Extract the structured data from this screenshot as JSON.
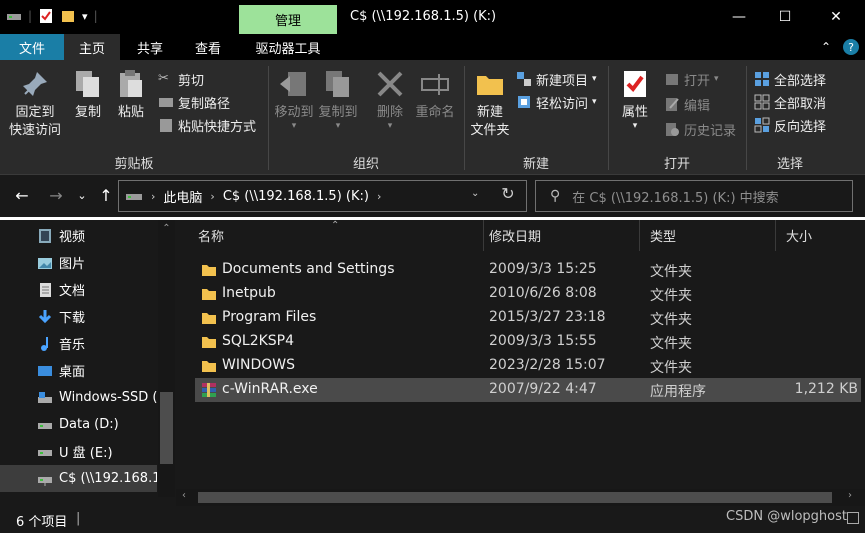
{
  "titlebar": {
    "manage_tab": "管理",
    "title": "C$ (\\\\192.168.1.5) (K:)",
    "minimize": "—",
    "maximize": "☐",
    "close": "✕",
    "qat_icons": [
      "drive-icon",
      "properties-check-icon",
      "new-folder-icon",
      "qat-dropdown-icon"
    ]
  },
  "tabs": {
    "file": "文件",
    "home": "主页",
    "share": "共享",
    "view": "查看",
    "drive_tools": "驱动器工具"
  },
  "ribbon": {
    "clipboard": {
      "label": "剪贴板",
      "pin_quick_access": "固定到\n快速访问",
      "pin_line1": "固定到",
      "pin_line2": "快速访问",
      "copy": "复制",
      "paste": "粘贴",
      "cut": "剪切",
      "copy_path": "复制路径",
      "paste_shortcut": "粘贴快捷方式"
    },
    "organize": {
      "label": "组织",
      "move_to": "移动到",
      "copy_to": "复制到",
      "delete": "删除",
      "rename": "重命名"
    },
    "new": {
      "label": "新建",
      "new_folder_line1": "新建",
      "new_folder_line2": "文件夹",
      "new_item": "新建项目",
      "easy_access": "轻松访问"
    },
    "open": {
      "label": "打开",
      "properties": "属性",
      "open": "打开",
      "edit": "编辑",
      "history": "历史记录"
    },
    "select": {
      "label": "选择",
      "select_all": "全部选择",
      "select_none": "全部取消",
      "invert": "反向选择"
    }
  },
  "address": {
    "this_pc": "此电脑",
    "drive": "C$ (\\\\192.168.1.5) (K:)",
    "search_placeholder": "在 C$ (\\\\192.168.1.5) (K:) 中搜索"
  },
  "navpane": {
    "items": [
      {
        "label": "视频",
        "icon": "video-icon"
      },
      {
        "label": "图片",
        "icon": "pictures-icon"
      },
      {
        "label": "文档",
        "icon": "documents-icon"
      },
      {
        "label": "下载",
        "icon": "downloads-icon"
      },
      {
        "label": "音乐",
        "icon": "music-icon"
      },
      {
        "label": "桌面",
        "icon": "desktop-icon"
      },
      {
        "label": "Windows-SSD (",
        "icon": "drive-icon"
      },
      {
        "label": "Data (D:)",
        "icon": "drive-icon"
      },
      {
        "label": "U 盘 (E:)",
        "icon": "usb-drive-icon"
      },
      {
        "label": "C$ (\\\\192.168.1",
        "icon": "network-drive-icon"
      }
    ]
  },
  "columns": {
    "name": "名称",
    "modified": "修改日期",
    "type": "类型",
    "size": "大小"
  },
  "files": [
    {
      "name": "Documents and Settings",
      "modified": "2009/3/3 15:25",
      "type": "文件夹",
      "size": "",
      "icon": "folder-icon"
    },
    {
      "name": "Inetpub",
      "modified": "2010/6/26 8:08",
      "type": "文件夹",
      "size": "",
      "icon": "folder-icon"
    },
    {
      "name": "Program Files",
      "modified": "2015/3/27 23:18",
      "type": "文件夹",
      "size": "",
      "icon": "folder-icon"
    },
    {
      "name": "SQL2KSP4",
      "modified": "2009/3/3 15:55",
      "type": "文件夹",
      "size": "",
      "icon": "folder-icon"
    },
    {
      "name": "WINDOWS",
      "modified": "2023/2/28 15:07",
      "type": "文件夹",
      "size": "",
      "icon": "folder-icon"
    },
    {
      "name": "c-WinRAR.exe",
      "modified": "2007/9/22 4:47",
      "type": "应用程序",
      "size": "1,212 KB",
      "icon": "winrar-icon"
    }
  ],
  "status": {
    "count": "6 个项目",
    "separator": "|",
    "watermark": "CSDN @wlopghost"
  },
  "colors": {
    "accent": "#1a7ea6",
    "manage_tab": "#9de29a",
    "folder": "#f2c14e",
    "background": "#191919"
  }
}
